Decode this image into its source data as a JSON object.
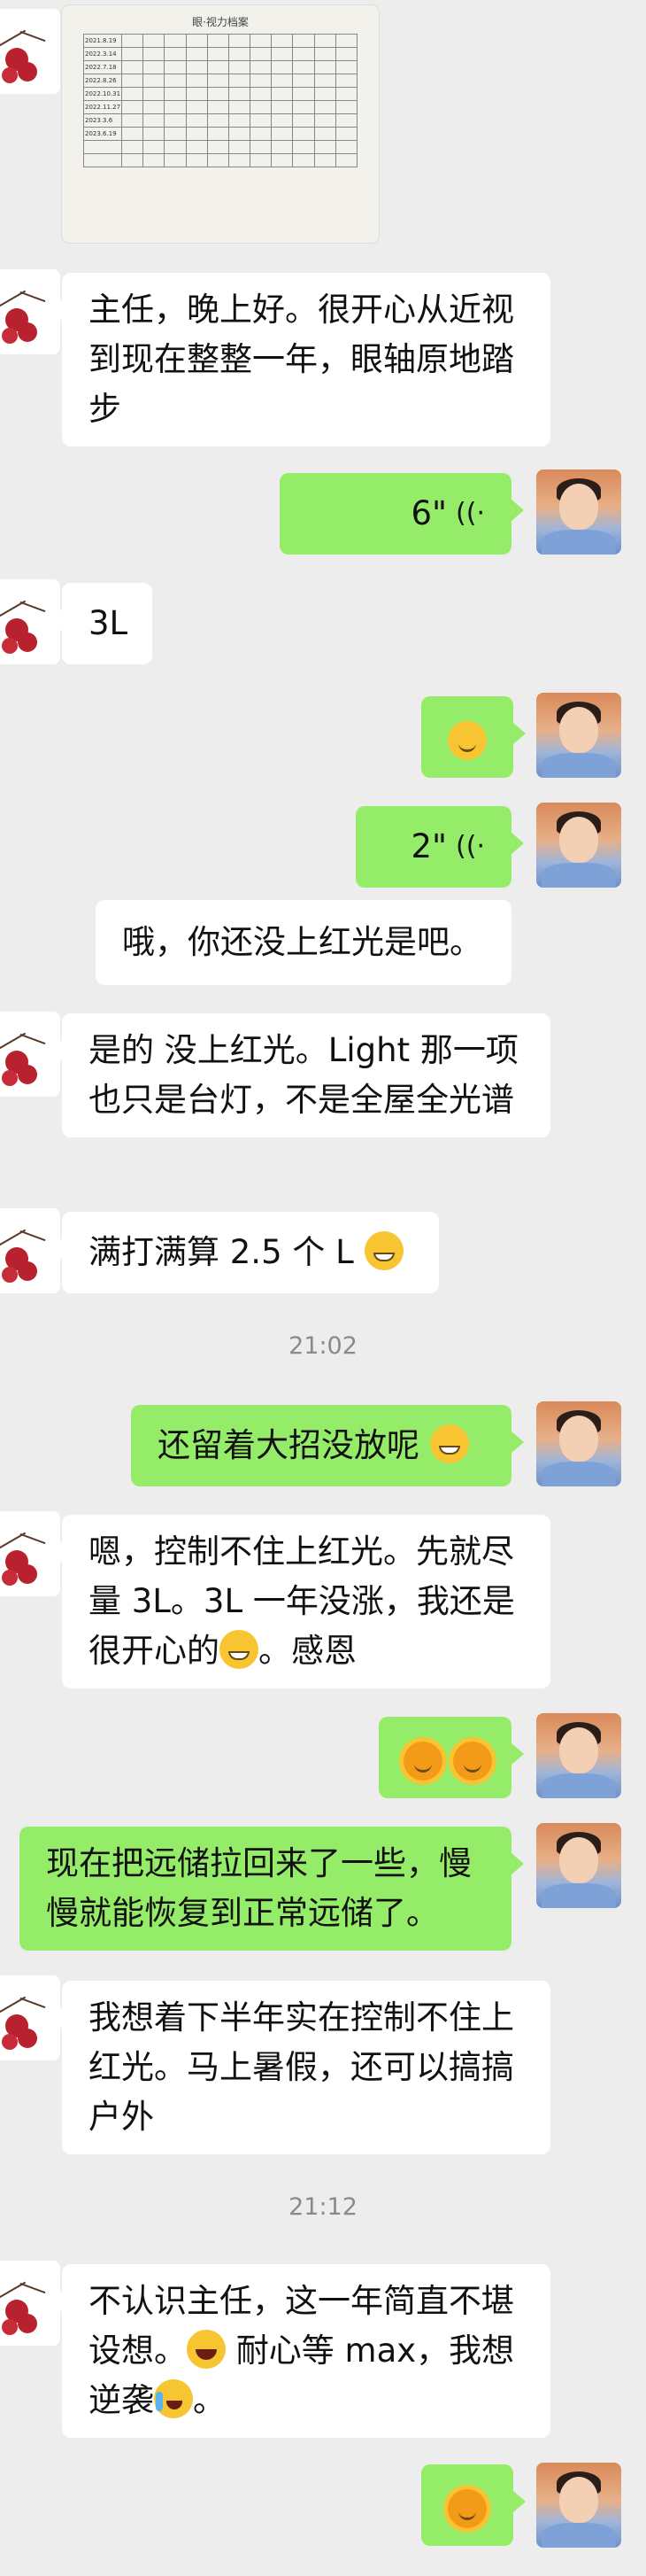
{
  "photo": {
    "header": "眼·视力档案",
    "rows": [
      "2021.8.19",
      "2022.3.14",
      "2022.7.18",
      "2022.8.26",
      "2022.10.31",
      "2022.11.27",
      "2023.3.6",
      "2023.6.19"
    ]
  },
  "messages": [
    {
      "text": "主任，晚上好。很开心从近视到现在整整一年，眼轴原地踏步"
    },
    {
      "voice": "6\""
    },
    {
      "text": "3L"
    },
    {
      "voice": "2\""
    },
    {
      "text": "哦，你还没上红光是吧。"
    },
    {
      "text": "是的 没上红光。Light 那一项也只是台灯，不是全屋全光谱"
    },
    {
      "text": "满打满算 2.5 个 L"
    },
    {
      "time": "21:02"
    },
    {
      "text": "还留着大招没放呢"
    },
    {
      "text_a": "嗯，控制不住上红光。先就尽量 3L。3L 一年没涨，我还是很开心的",
      "text_b": "。感恩"
    },
    {
      "text": "现在把远储拉回来了一些，慢慢就能恢复到正常远储了。"
    },
    {
      "text": "我想着下半年实在控制不住上红光。马上暑假，还可以搞搞户外"
    },
    {
      "time": "21:12"
    },
    {
      "text_a": "不认识主任，这一年简直不堪设想。",
      "text_b": "耐心等 max，我想逆袭",
      "text_c": "。"
    }
  ],
  "icons": {
    "voice_wave": "voice-wave-icon",
    "emoji_grin": "grin-emoji",
    "emoji_smile": "smile-emoji",
    "emoji_sun": "sun-emoji",
    "emoji_laugh": "tears-of-joy-emoji",
    "emoji_cry": "rofl-emoji"
  },
  "colors": {
    "background": "#ededed",
    "incoming": "#ffffff",
    "outgoing": "#95ec69",
    "timestamp": "#8a8a8a"
  }
}
